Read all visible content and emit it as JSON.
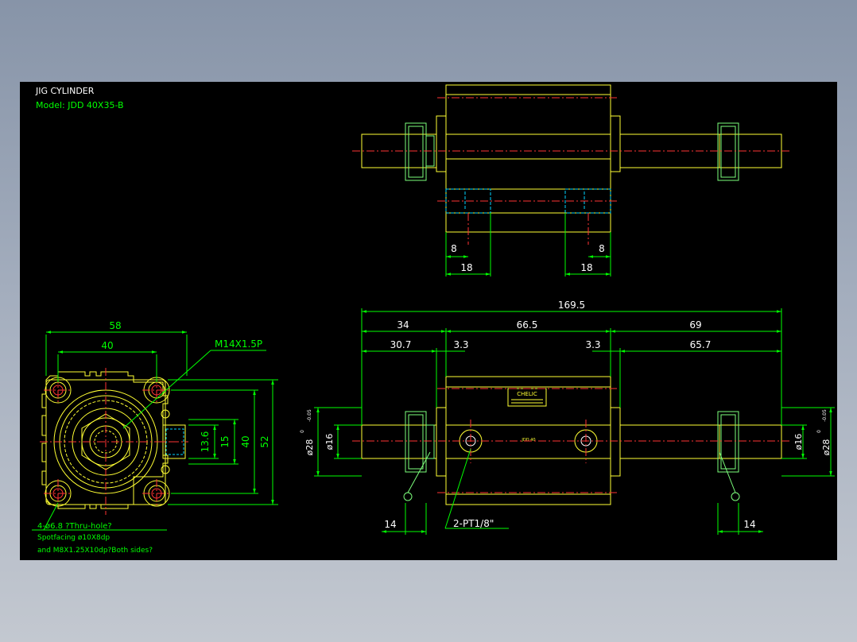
{
  "title_block": {
    "title": "JIG CYLINDER",
    "model": "Model: JDD 40X35-B"
  },
  "colors": {
    "background": "#000000",
    "outline": "#ffff33",
    "dimension": "#00ff00",
    "centerline": "#ff3333",
    "hidden": "#00d5ff",
    "nut": "#7cff7c",
    "port": "#ffffff"
  },
  "front_view": {
    "dims": {
      "width_58": "58",
      "width_40": "40",
      "height_13_6": "13.6",
      "height_15": "15",
      "height_40": "40",
      "height_52": "52"
    },
    "thread_label": "M14X1.5P",
    "notes": {
      "holes": "4-ø6.8 ?Thru-hole?",
      "spotfacing": "Spotfacing  ø10X8dp",
      "tapped": "and M8X1.25X10dp?Both sides?"
    }
  },
  "top_view": {
    "dims": {
      "left_8": "8",
      "right_8": "8",
      "left_18": "18",
      "right_18": "18"
    }
  },
  "side_view": {
    "dims": {
      "overall": "169.5",
      "left_34": "34",
      "mid_66_5": "66.5",
      "right_69": "69",
      "left_30_7": "30.7",
      "left_3_3": "3.3",
      "right_3_3": "3.3",
      "right_65_7": "65.7",
      "left_dia16": "ø16",
      "left_dia28": "ø28",
      "left_tol_top": "0",
      "left_tol_bottom": "-0.05",
      "right_dia16": "ø16",
      "right_dia28": "ø28",
      "right_tol_top": "0",
      "right_tol_bottom": "-0.05",
      "left_14": "14",
      "right_14": "14"
    },
    "port_label": "2-PT1/8\"",
    "body_marking": "JDD 40",
    "nameplate": "CHELIC"
  }
}
